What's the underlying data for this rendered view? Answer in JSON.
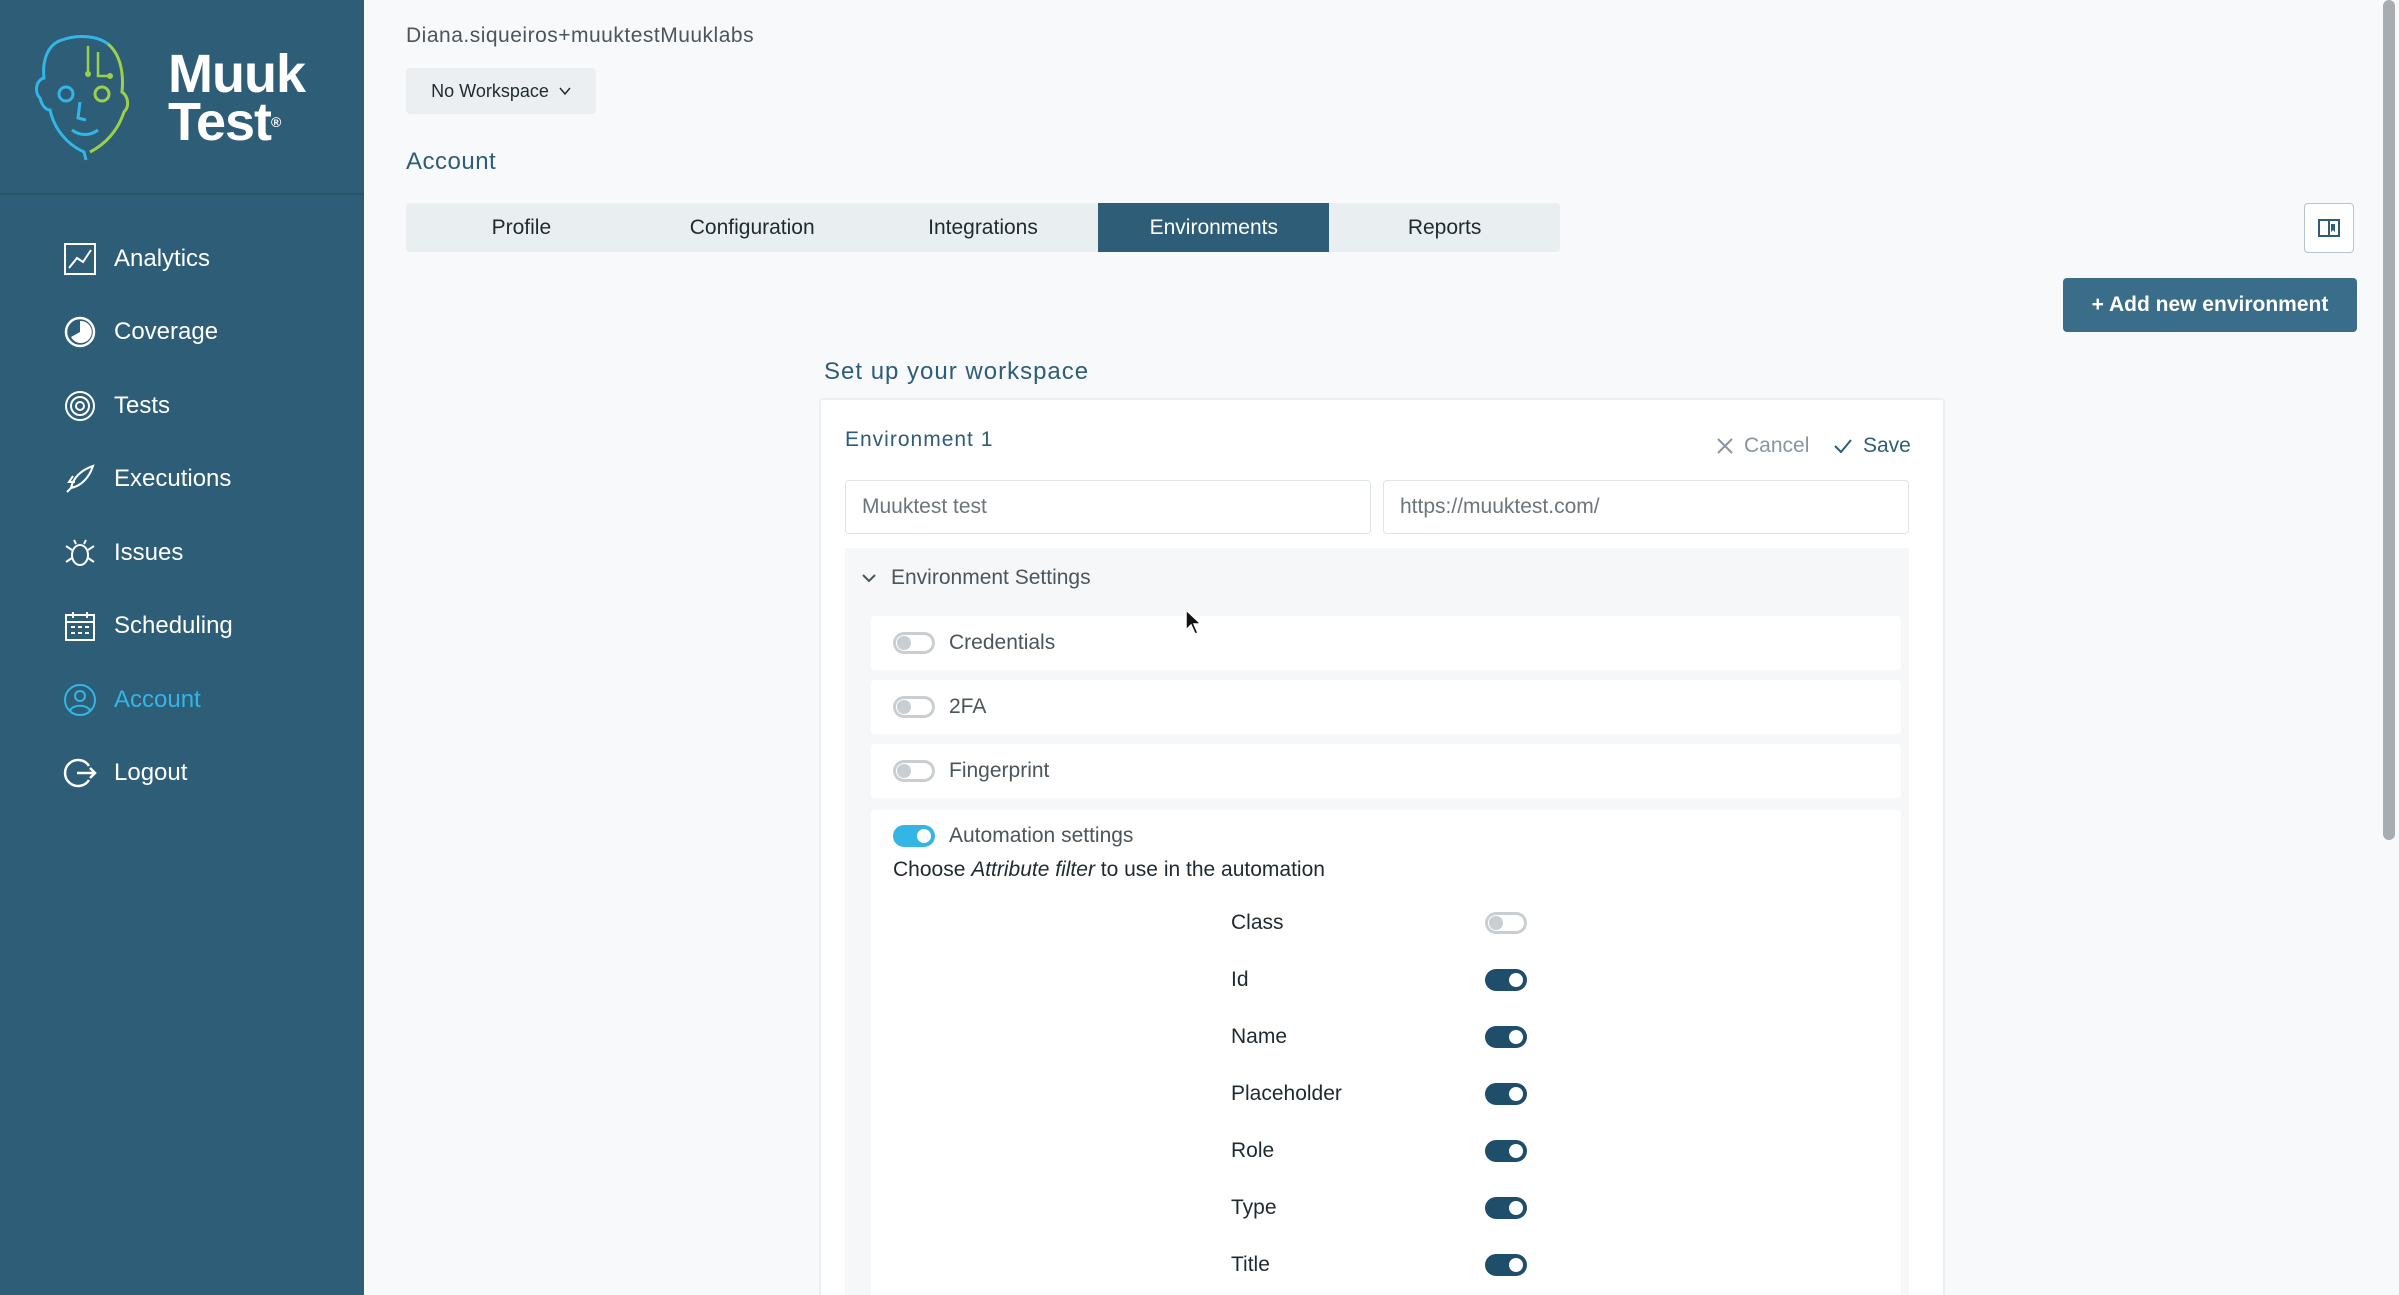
{
  "sidebar": {
    "logo": {
      "line1": "Muuk",
      "line2": "Test",
      "mark": "®"
    },
    "items": [
      {
        "label": "Analytics",
        "icon": "analytics-icon"
      },
      {
        "label": "Coverage",
        "icon": "coverage-icon"
      },
      {
        "label": "Tests",
        "icon": "tests-icon"
      },
      {
        "label": "Executions",
        "icon": "executions-icon"
      },
      {
        "label": "Issues",
        "icon": "issues-icon"
      },
      {
        "label": "Scheduling",
        "icon": "scheduling-icon"
      },
      {
        "label": "Account",
        "icon": "account-icon",
        "active": true
      },
      {
        "label": "Logout",
        "icon": "logout-icon"
      }
    ]
  },
  "header": {
    "username": "Diana.siqueiros+muuktestMuuklabs",
    "workspace": "No Workspace",
    "page_title": "Account"
  },
  "tabs": [
    {
      "label": "Profile"
    },
    {
      "label": "Configuration"
    },
    {
      "label": "Integrations"
    },
    {
      "label": "Environments",
      "active": true
    },
    {
      "label": "Reports"
    }
  ],
  "actions": {
    "add_environment": "+ Add new environment"
  },
  "workspace_setup": {
    "title": "Set up your workspace",
    "environment": {
      "title": "Environment 1",
      "cancel": "Cancel",
      "save": "Save",
      "name_value": "Muuktest test",
      "url_value": "https://muuktest.com/"
    },
    "settings": {
      "header": "Environment Settings",
      "credentials": {
        "label": "Credentials",
        "enabled": false
      },
      "twofa": {
        "label": "2FA",
        "enabled": false
      },
      "fingerprint": {
        "label": "Fingerprint",
        "enabled": false
      },
      "automation": {
        "label": "Automation settings",
        "enabled": true,
        "desc_prefix": "Choose ",
        "desc_em": "Attribute filter",
        "desc_suffix": " to use in the automation",
        "attributes": [
          {
            "label": "Class",
            "enabled": false
          },
          {
            "label": "Id",
            "enabled": true
          },
          {
            "label": "Name",
            "enabled": true
          },
          {
            "label": "Placeholder",
            "enabled": true
          },
          {
            "label": "Role",
            "enabled": true
          },
          {
            "label": "Type",
            "enabled": true
          },
          {
            "label": "Title",
            "enabled": true
          }
        ]
      }
    }
  },
  "colors": {
    "sidebar": "#2d5d77",
    "accent": "#33b5e5",
    "toggle_on": "#1e4e6a"
  }
}
